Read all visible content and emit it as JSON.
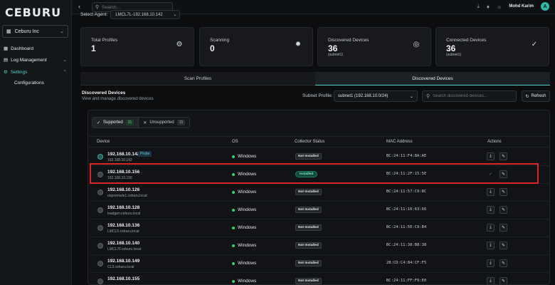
{
  "brand": {
    "logo": "CEBURU"
  },
  "sidebar": {
    "org": "Ceburu Inc",
    "items": [
      {
        "label": "Dashboard"
      },
      {
        "label": "Log Management"
      },
      {
        "label": "Settings"
      }
    ],
    "sub_item": "Configurations"
  },
  "topbar": {
    "search_placeholder": "Search...",
    "user_name": "Mohd Karim",
    "avatar_initial": "A"
  },
  "agent": {
    "label": "Select Agent:",
    "value": "LMCL7L-192.168.10.142"
  },
  "stats": [
    {
      "label": "Total Profiles",
      "value": "1",
      "sub": "",
      "icon": "gear-icon"
    },
    {
      "label": "Scanning",
      "value": "0",
      "sub": "",
      "icon": "spinner-icon"
    },
    {
      "label": "Discovered Devices",
      "value": "36",
      "sub": "(subnet1)",
      "icon": "target-icon"
    },
    {
      "label": "Connected Devices",
      "value": "36",
      "sub": "(subnet1)",
      "icon": "check-circle-icon"
    }
  ],
  "tabs": [
    {
      "label": "Scan Profiles"
    },
    {
      "label": "Discovered Devices"
    }
  ],
  "discovered": {
    "title": "Discovered Devices",
    "subtitle": "View and manage discovered devices",
    "subnet_label": "Subnet Profile:",
    "subnet_value": "subnet1 (192.168.10.0/24)",
    "search_placeholder": "Search discovered devices...",
    "refresh_label": "Refresh"
  },
  "filters": {
    "supported_label": "Supported",
    "supported_count": "21",
    "unsupported_label": "Unsupported",
    "unsupported_count": "15"
  },
  "table": {
    "headers": [
      "Device",
      "OS",
      "Collector Status",
      "MAC Address",
      "Actions"
    ],
    "rows": [
      {
        "ip": "192.168.10.142",
        "host": "192.168.10.142",
        "probe": "Probe",
        "os": "Windows",
        "status": "Not Installed",
        "mac": "BC:24:11:F4:8A:AE"
      },
      {
        "ip": "192.168.10.156",
        "host": "192.168.10.156",
        "probe": "",
        "os": "Windows",
        "status": "Installed",
        "mac": "BC:24:11:2F:15:5E"
      },
      {
        "ip": "192.168.10.126",
        "host": "onpremwin1.ceburu.local",
        "probe": "",
        "os": "Windows",
        "status": "Not Installed",
        "mac": "BC:24:11:57:C9:BC"
      },
      {
        "ip": "192.168.10.128",
        "host": "loadgen.ceburu.local",
        "probe": "",
        "os": "Windows",
        "status": "Not Installed",
        "mac": "BC:24:11:16:63:66"
      },
      {
        "ip": "192.168.10.136",
        "host": "LMCL5.ceburu.local",
        "probe": "",
        "os": "Windows",
        "status": "Not Installed",
        "mac": "BC:24:11:5E:C9:B4"
      },
      {
        "ip": "192.168.10.140",
        "host": "LMCL7F.ceburu.local",
        "probe": "",
        "os": "Windows",
        "status": "Not Installed",
        "mac": "BC:24:11:38:B8:38"
      },
      {
        "ip": "192.168.10.149",
        "host": "CL3.ceburu.local",
        "probe": "",
        "os": "Windows",
        "status": "Not Installed",
        "mac": "28:CD:C4:84:CF:F5"
      },
      {
        "ip": "192.168.10.155",
        "host": "",
        "probe": "",
        "os": "Windows",
        "status": "Not Installed",
        "mac": "BC:24:11:FF:F9:E0"
      }
    ]
  },
  "colors": {
    "accent": "#4fd1c5",
    "highlight": "#d92626",
    "installed": "#0f4a3c",
    "ok_dot": "#3ecf6e"
  }
}
